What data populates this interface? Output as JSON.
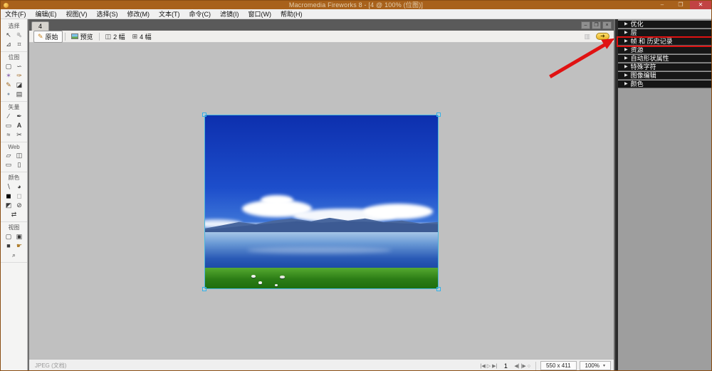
{
  "window": {
    "title": "Macromedia Fireworks 8 - [4 @ 100% (位图)]",
    "minimize": "–",
    "restore": "❐",
    "close": "✕"
  },
  "menu": {
    "items": [
      "文件(F)",
      "编辑(E)",
      "视图(V)",
      "选择(S)",
      "修改(M)",
      "文本(T)",
      "命令(C)",
      "滤镜(I)",
      "窗口(W)",
      "帮助(H)"
    ]
  },
  "toolbox": {
    "sections": [
      {
        "label": "选择",
        "tools": [
          {
            "name": "pointer-tool",
            "glyph": "↖"
          },
          {
            "name": "subselection-tool",
            "glyph": "↖"
          },
          {
            "name": "scale-tool",
            "glyph": "⊿"
          },
          {
            "name": "crop-tool",
            "glyph": "⌗"
          }
        ]
      },
      {
        "label": "位图",
        "tools": [
          {
            "name": "marquee-tool",
            "glyph": "▢"
          },
          {
            "name": "lasso-tool",
            "glyph": "∽"
          },
          {
            "name": "magic-wand-tool",
            "glyph": "✶"
          },
          {
            "name": "brush-tool",
            "glyph": "✑"
          },
          {
            "name": "pencil-tool",
            "glyph": "✎"
          },
          {
            "name": "eraser-tool",
            "glyph": "◪"
          },
          {
            "name": "blur-tool",
            "glyph": "●"
          },
          {
            "name": "rubber-stamp-tool",
            "glyph": "▤"
          }
        ]
      },
      {
        "label": "矢量",
        "tools": [
          {
            "name": "line-tool",
            "glyph": "∕"
          },
          {
            "name": "pen-tool",
            "glyph": "✒"
          },
          {
            "name": "rectangle-tool",
            "glyph": "▭"
          },
          {
            "name": "text-tool",
            "glyph": "A"
          },
          {
            "name": "freeform-tool",
            "glyph": "≈"
          },
          {
            "name": "knife-tool",
            "glyph": "✂"
          }
        ]
      },
      {
        "label": "Web",
        "tools": [
          {
            "name": "hotspot-tool",
            "glyph": "▱"
          },
          {
            "name": "slice-tool",
            "glyph": "◫"
          },
          {
            "name": "hide-slices-button",
            "glyph": "▭"
          },
          {
            "name": "show-slices-button",
            "glyph": "▯"
          }
        ]
      },
      {
        "label": "颜色",
        "tools": [
          {
            "name": "eyedropper-tool",
            "glyph": "∖"
          },
          {
            "name": "paint-bucket-tool",
            "glyph": "◕"
          },
          {
            "name": "stroke-color-well",
            "glyph": "◼"
          },
          {
            "name": "fill-color-well",
            "glyph": "◻"
          },
          {
            "name": "default-colors-button",
            "glyph": "◩"
          },
          {
            "name": "no-color-button",
            "glyph": "⊘"
          },
          {
            "name": "swap-colors-button",
            "glyph": "⇄"
          }
        ]
      },
      {
        "label": "视图",
        "tools": [
          {
            "name": "standard-screen-button",
            "glyph": "▢"
          },
          {
            "name": "screen-with-menus-button",
            "glyph": "▣"
          },
          {
            "name": "full-screen-button",
            "glyph": "■"
          },
          {
            "name": "hand-tool",
            "glyph": "☛"
          },
          {
            "name": "zoom-tool",
            "glyph": "⌕"
          }
        ]
      }
    ]
  },
  "document": {
    "tab_label": "4",
    "minimize": "–",
    "restore": "❐",
    "close": "×",
    "view_modes": [
      {
        "name": "original",
        "label": "原始",
        "icon": "pencil-icon",
        "glyph": "✎",
        "active": true
      },
      {
        "name": "preview",
        "label": "预览",
        "icon": "image-icon",
        "glyph": "",
        "active": false
      },
      {
        "name": "two-up",
        "label": "2 幅",
        "icon": "two-up-icon",
        "glyph": "◫",
        "active": false
      },
      {
        "name": "four-up",
        "label": "4 幅",
        "icon": "four-up-icon",
        "glyph": "⊞",
        "active": false
      }
    ],
    "quick_export_glyph": "➜",
    "pages_glyph": "▥"
  },
  "statusbar": {
    "format_label": "JPEG (文档)",
    "playback_left": [
      {
        "name": "first-frame-button",
        "glyph": "|◀"
      },
      {
        "name": "play-button",
        "glyph": "▷"
      },
      {
        "name": "last-frame-button",
        "glyph": "▶|"
      }
    ],
    "frame": "1",
    "playback_right": [
      {
        "name": "previous-frame-button",
        "glyph": "◀|"
      },
      {
        "name": "next-frame-button",
        "glyph": "|▶"
      },
      {
        "name": "loop-button",
        "glyph": "○"
      }
    ],
    "canvas_size": "550 x 411",
    "zoom_level": "100%",
    "zoom_caret": "▾"
  },
  "dock": {
    "expander_glyph": "▶",
    "panels": [
      {
        "label": "优化",
        "highlighted": false
      },
      {
        "label": "层",
        "highlighted": false
      },
      {
        "label": "帧 和 历史记录",
        "highlighted": true
      },
      {
        "label": "资源",
        "highlighted": false
      },
      {
        "label": "自动形状属性",
        "highlighted": false
      },
      {
        "label": "特殊字符",
        "highlighted": false
      },
      {
        "label": "图像编辑",
        "highlighted": false
      },
      {
        "label": "颜色",
        "highlighted": false
      }
    ]
  },
  "annotation": {
    "arrow_color": "#e01212",
    "highlight_border_color": "#e01212",
    "highlighted_panel": "帧 和 历史记录"
  },
  "colors": {
    "titlebar": "#a8611b",
    "mdi_background": "#6e6e6e",
    "canvas_background": "#c0c0c0",
    "dock_header": "#161616",
    "selection_handle": "#35b0e6"
  }
}
